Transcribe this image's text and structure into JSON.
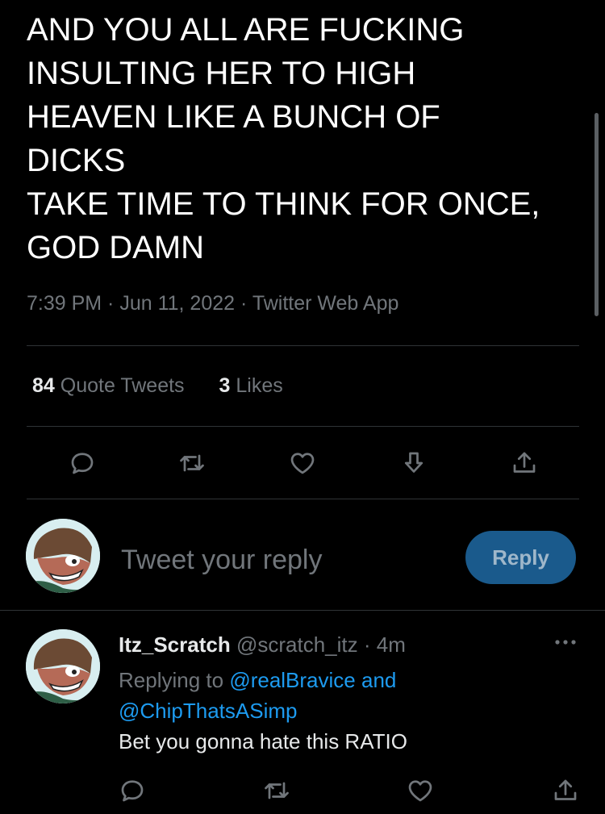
{
  "tweet": {
    "text": "AND YOU ALL ARE FUCKING\nINSULTING HER TO HIGH\nHEAVEN LIKE A BUNCH OF\nDICKS\nTAKE TIME TO THINK FOR ONCE,\nGOD DAMN",
    "time": "7:39 PM",
    "date": "Jun 11, 2022",
    "source": "Twitter Web App",
    "sep": " · "
  },
  "stats": {
    "quote_count": "84",
    "quote_label": "Quote Tweets",
    "likes_count": "3",
    "likes_label": "Likes"
  },
  "actions": [
    "reply-icon",
    "retweet-icon",
    "like-icon",
    "bookmark-icon",
    "share-icon"
  ],
  "composer": {
    "placeholder": "Tweet your reply",
    "button": "Reply"
  },
  "reply": {
    "name": "Itz_Scratch",
    "handle": "@scratch_itz",
    "sep": " · ",
    "age": "4m",
    "replying_prefix": "Replying to ",
    "mention1": "@realBravice and",
    "mention2": "@ChipThatsASimp",
    "text": "Bet you gonna hate this RATIO"
  },
  "colors": {
    "background": "#000000",
    "muted": "#71767b",
    "accent": "#1d9bf0",
    "reply_button": "#1a5a8c"
  }
}
